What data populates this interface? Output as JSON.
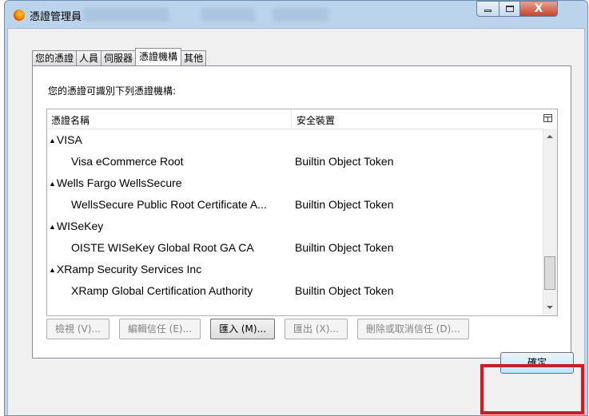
{
  "window": {
    "title": "憑證管理員"
  },
  "tabs": [
    {
      "label": "您的憑證"
    },
    {
      "label": "人員"
    },
    {
      "label": "伺服器"
    },
    {
      "label": "憑證機構",
      "active": true
    },
    {
      "label": "其他"
    }
  ],
  "panel": {
    "description": "您的憑證可識別下列憑證機構:",
    "columns": {
      "name": "憑證名稱",
      "device": "安全裝置"
    },
    "rows": [
      {
        "type": "group",
        "label": "VISA"
      },
      {
        "type": "item",
        "name": "Visa eCommerce Root",
        "token": "Builtin Object Token"
      },
      {
        "type": "group",
        "label": "Wells Fargo WellsSecure"
      },
      {
        "type": "item",
        "name": "WellsSecure Public Root Certificate A...",
        "token": "Builtin Object Token"
      },
      {
        "type": "group",
        "label": "WISeKey"
      },
      {
        "type": "item",
        "name": "OISTE WISeKey Global Root GA CA",
        "token": "Builtin Object Token"
      },
      {
        "type": "group",
        "label": "XRamp Security Services Inc"
      },
      {
        "type": "item",
        "name": "XRamp Global Certification Authority",
        "token": "Builtin Object Token"
      }
    ]
  },
  "actions": {
    "view": "檢視 (V)...",
    "edit_trust": "編輯信任 (E)...",
    "import": "匯入 (M)...",
    "export": "匯出 (X)...",
    "delete": "刪除或取消信任 (D)..."
  },
  "ok_label": "確定",
  "icons": {
    "expand": "▲",
    "close": "X"
  },
  "colors": {
    "highlight": "#e0141e",
    "title_bar": "#bcd3ec"
  }
}
